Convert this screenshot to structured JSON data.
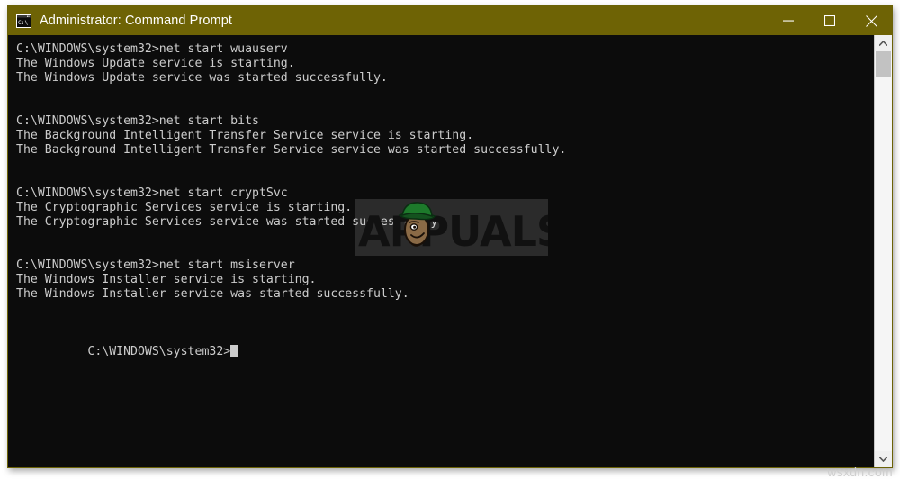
{
  "window": {
    "title": "Administrator: Command Prompt",
    "icon": "command-prompt-icon",
    "titlebar_color": "#6e6305",
    "background_color": "#0c0c0c",
    "text_color": "#cccccc",
    "controls": {
      "minimize_label": "Minimize",
      "maximize_label": "Maximize",
      "close_label": "Close"
    }
  },
  "console": {
    "prompt": "C:\\WINDOWS\\system32>",
    "lines": [
      "C:\\WINDOWS\\system32>net start wuauserv",
      "The Windows Update service is starting.",
      "The Windows Update service was started successfully.",
      "",
      "",
      "C:\\WINDOWS\\system32>net start bits",
      "The Background Intelligent Transfer Service service is starting.",
      "The Background Intelligent Transfer Service service was started successfully.",
      "",
      "",
      "C:\\WINDOWS\\system32>net start cryptSvc",
      "The Cryptographic Services service is starting.",
      "The Cryptographic Services service was started successfully.",
      "",
      "",
      "C:\\WINDOWS\\system32>net start msiserver",
      "The Windows Installer service is starting.",
      "The Windows Installer service was started successfully.",
      "",
      ""
    ],
    "final_prompt": "C:\\WINDOWS\\system32>",
    "cursor": "block-cursor"
  },
  "scrollbar": {
    "up_arrow": "chevron-up-icon",
    "down_arrow": "chevron-down-icon",
    "thumb": "scrollbar-thumb"
  },
  "watermark": {
    "text": "APPUALS",
    "mascot": "appuals-mascot-icon"
  },
  "credit": {
    "text": "wsxdn.com"
  }
}
